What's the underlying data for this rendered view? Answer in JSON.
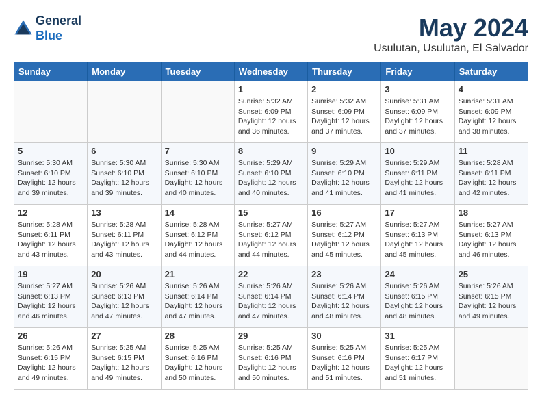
{
  "header": {
    "logo_general": "General",
    "logo_blue": "Blue",
    "month_title": "May 2024",
    "location": "Usulutan, Usulutan, El Salvador"
  },
  "calendar": {
    "days_of_week": [
      "Sunday",
      "Monday",
      "Tuesday",
      "Wednesday",
      "Thursday",
      "Friday",
      "Saturday"
    ],
    "weeks": [
      [
        {
          "day": "",
          "info": ""
        },
        {
          "day": "",
          "info": ""
        },
        {
          "day": "",
          "info": ""
        },
        {
          "day": "1",
          "info": "Sunrise: 5:32 AM\nSunset: 6:09 PM\nDaylight: 12 hours\nand 36 minutes."
        },
        {
          "day": "2",
          "info": "Sunrise: 5:32 AM\nSunset: 6:09 PM\nDaylight: 12 hours\nand 37 minutes."
        },
        {
          "day": "3",
          "info": "Sunrise: 5:31 AM\nSunset: 6:09 PM\nDaylight: 12 hours\nand 37 minutes."
        },
        {
          "day": "4",
          "info": "Sunrise: 5:31 AM\nSunset: 6:09 PM\nDaylight: 12 hours\nand 38 minutes."
        }
      ],
      [
        {
          "day": "5",
          "info": "Sunrise: 5:30 AM\nSunset: 6:10 PM\nDaylight: 12 hours\nand 39 minutes."
        },
        {
          "day": "6",
          "info": "Sunrise: 5:30 AM\nSunset: 6:10 PM\nDaylight: 12 hours\nand 39 minutes."
        },
        {
          "day": "7",
          "info": "Sunrise: 5:30 AM\nSunset: 6:10 PM\nDaylight: 12 hours\nand 40 minutes."
        },
        {
          "day": "8",
          "info": "Sunrise: 5:29 AM\nSunset: 6:10 PM\nDaylight: 12 hours\nand 40 minutes."
        },
        {
          "day": "9",
          "info": "Sunrise: 5:29 AM\nSunset: 6:10 PM\nDaylight: 12 hours\nand 41 minutes."
        },
        {
          "day": "10",
          "info": "Sunrise: 5:29 AM\nSunset: 6:11 PM\nDaylight: 12 hours\nand 41 minutes."
        },
        {
          "day": "11",
          "info": "Sunrise: 5:28 AM\nSunset: 6:11 PM\nDaylight: 12 hours\nand 42 minutes."
        }
      ],
      [
        {
          "day": "12",
          "info": "Sunrise: 5:28 AM\nSunset: 6:11 PM\nDaylight: 12 hours\nand 43 minutes."
        },
        {
          "day": "13",
          "info": "Sunrise: 5:28 AM\nSunset: 6:11 PM\nDaylight: 12 hours\nand 43 minutes."
        },
        {
          "day": "14",
          "info": "Sunrise: 5:28 AM\nSunset: 6:12 PM\nDaylight: 12 hours\nand 44 minutes."
        },
        {
          "day": "15",
          "info": "Sunrise: 5:27 AM\nSunset: 6:12 PM\nDaylight: 12 hours\nand 44 minutes."
        },
        {
          "day": "16",
          "info": "Sunrise: 5:27 AM\nSunset: 6:12 PM\nDaylight: 12 hours\nand 45 minutes."
        },
        {
          "day": "17",
          "info": "Sunrise: 5:27 AM\nSunset: 6:13 PM\nDaylight: 12 hours\nand 45 minutes."
        },
        {
          "day": "18",
          "info": "Sunrise: 5:27 AM\nSunset: 6:13 PM\nDaylight: 12 hours\nand 46 minutes."
        }
      ],
      [
        {
          "day": "19",
          "info": "Sunrise: 5:27 AM\nSunset: 6:13 PM\nDaylight: 12 hours\nand 46 minutes."
        },
        {
          "day": "20",
          "info": "Sunrise: 5:26 AM\nSunset: 6:13 PM\nDaylight: 12 hours\nand 47 minutes."
        },
        {
          "day": "21",
          "info": "Sunrise: 5:26 AM\nSunset: 6:14 PM\nDaylight: 12 hours\nand 47 minutes."
        },
        {
          "day": "22",
          "info": "Sunrise: 5:26 AM\nSunset: 6:14 PM\nDaylight: 12 hours\nand 47 minutes."
        },
        {
          "day": "23",
          "info": "Sunrise: 5:26 AM\nSunset: 6:14 PM\nDaylight: 12 hours\nand 48 minutes."
        },
        {
          "day": "24",
          "info": "Sunrise: 5:26 AM\nSunset: 6:15 PM\nDaylight: 12 hours\nand 48 minutes."
        },
        {
          "day": "25",
          "info": "Sunrise: 5:26 AM\nSunset: 6:15 PM\nDaylight: 12 hours\nand 49 minutes."
        }
      ],
      [
        {
          "day": "26",
          "info": "Sunrise: 5:26 AM\nSunset: 6:15 PM\nDaylight: 12 hours\nand 49 minutes."
        },
        {
          "day": "27",
          "info": "Sunrise: 5:25 AM\nSunset: 6:15 PM\nDaylight: 12 hours\nand 49 minutes."
        },
        {
          "day": "28",
          "info": "Sunrise: 5:25 AM\nSunset: 6:16 PM\nDaylight: 12 hours\nand 50 minutes."
        },
        {
          "day": "29",
          "info": "Sunrise: 5:25 AM\nSunset: 6:16 PM\nDaylight: 12 hours\nand 50 minutes."
        },
        {
          "day": "30",
          "info": "Sunrise: 5:25 AM\nSunset: 6:16 PM\nDaylight: 12 hours\nand 51 minutes."
        },
        {
          "day": "31",
          "info": "Sunrise: 5:25 AM\nSunset: 6:17 PM\nDaylight: 12 hours\nand 51 minutes."
        },
        {
          "day": "",
          "info": ""
        }
      ]
    ]
  }
}
